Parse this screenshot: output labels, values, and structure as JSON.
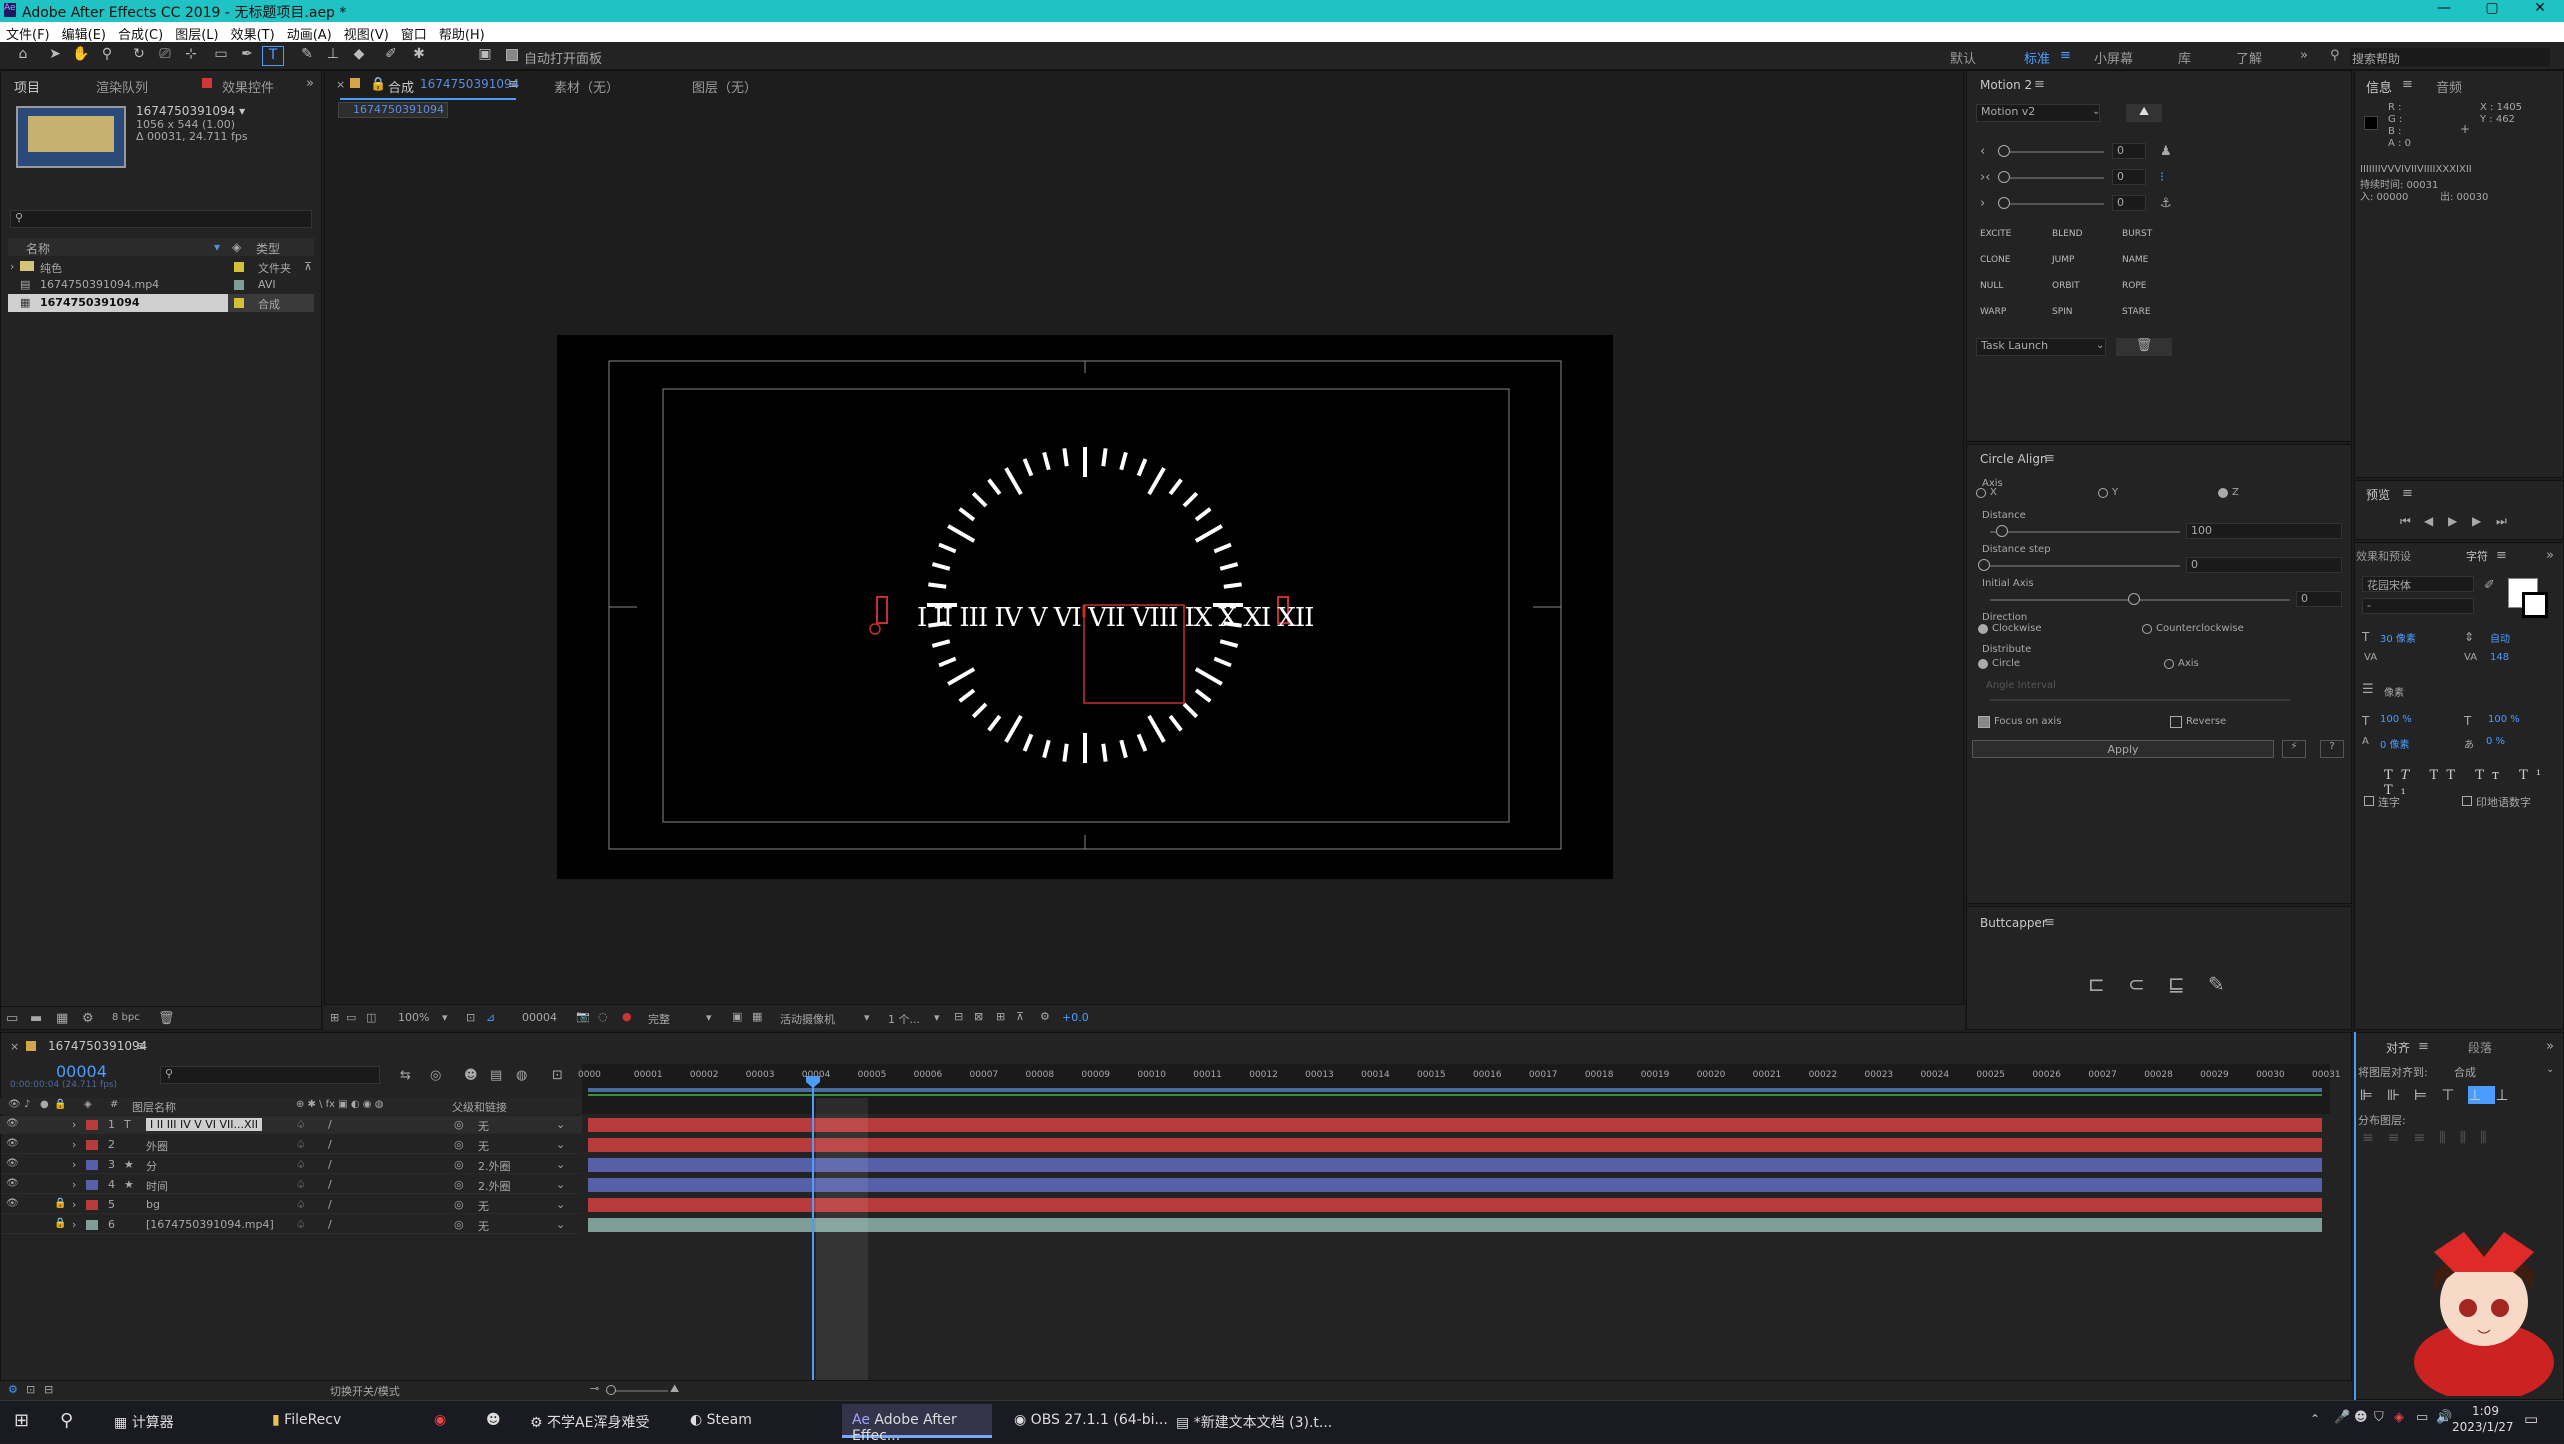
{
  "window": {
    "title": "Adobe After Effects CC 2019 - 无标题项目.aep *",
    "controls": [
      "—",
      "▢",
      "✕"
    ]
  },
  "menu": [
    "文件(F)",
    "编辑(E)",
    "合成(C)",
    "图层(L)",
    "效果(T)",
    "动画(A)",
    "视图(V)",
    "窗口",
    "帮助(H)"
  ],
  "toolbar": {
    "auto_open": "自动打开面板",
    "workspaces": [
      "默认",
      "标准",
      "小屏幕",
      "库",
      "了解"
    ],
    "active_ws": "标准",
    "search_placeholder": "搜索帮助"
  },
  "project": {
    "tabs": [
      "项目",
      "渲染队列",
      "效果控件"
    ],
    "item_name": "1674750391094 ▾",
    "item_dims": "1056 x 544 (1.00)",
    "item_dur": "Δ 00031, 24.711 fps",
    "cols": {
      "name": "名称",
      "type": "类型"
    },
    "items": [
      {
        "name": "纯色",
        "type": "文件夹"
      },
      {
        "name": "1674750391094.mp4",
        "type": "AVI"
      },
      {
        "name": "1674750391094",
        "type": "合成"
      }
    ],
    "bpc": "8 bpc"
  },
  "comp": {
    "tab_label": "合成",
    "tab_name": "1674750391094",
    "footage_tab": "素材（无）",
    "layer_tab": "图层（无）",
    "breadcrumb": "1674750391094",
    "clock_text": "I II III IV V VI VII VIII IX X XI XII",
    "bottom": {
      "zoom": "100%",
      "frame": "00004",
      "quality": "完整",
      "camera": "活动摄像机",
      "views": "1 个...",
      "exposure": "+0.0"
    }
  },
  "motion2": {
    "title": "Motion 2",
    "version": "Motion v2",
    "slider_values": [
      "0",
      "0",
      "0"
    ],
    "buttons": [
      "EXCITE",
      "BLEND",
      "BURST",
      "CLONE",
      "JUMP",
      "NAME",
      "NULL",
      "ORBIT",
      "ROPE",
      "WARP",
      "SPIN",
      "STARE"
    ],
    "task": "Task Launch"
  },
  "circle_align": {
    "title": "Circle Align",
    "axis_label": "Axis",
    "axes": [
      "X",
      "Y",
      "Z"
    ],
    "distance_label": "Distance",
    "distance": "100",
    "distance_step_label": "Distance step",
    "distance_step": "0",
    "initial_axis_label": "Initial Axis",
    "initial_axis": "0",
    "direction_label": "Direction",
    "dir_cw": "Clockwise",
    "dir_ccw": "Counterclockwise",
    "distribute_label": "Distribute",
    "dist_circle": "Circle",
    "dist_axis": "Axis",
    "angle_interval": "Angle Interval",
    "focus": "Focus on axis",
    "reverse": "Reverse",
    "apply": "Apply"
  },
  "buttcapper": {
    "title": "Buttcapper"
  },
  "info": {
    "tabs": [
      "信息",
      "音频"
    ],
    "rgba": [
      "R :",
      "G :",
      "B :",
      "A : 0"
    ],
    "x": "X : 1405",
    "y": "Y : 462",
    "text_line": "IIIIIIIVVVIVIIVIIIIXXXIXII",
    "dur": "持续时间: 00031",
    "in": "入: 00000",
    "out": "出: 00030"
  },
  "preview": {
    "title": "预览"
  },
  "character": {
    "tabs": [
      "效果和预设",
      "字符"
    ],
    "font": "花园宋体",
    "style": "-",
    "size": "30 像素",
    "leading": "自动",
    "tracking": "148",
    "units": "像素",
    "scale_v": "100 %",
    "scale_h": "100 %",
    "baseline": "0 像素",
    "tsume": "0 %",
    "ligature": "连字",
    "hindi": "印地语数字"
  },
  "align": {
    "tabs": [
      "对齐",
      "段落"
    ],
    "align_to": "将图层对齐到:",
    "align_target": "合成",
    "distribute": "分布图层:"
  },
  "timeline": {
    "tab_name": "1674750391094",
    "timecode": "00004",
    "timecode_sub": "0:00:00:04 (24.711 fps)",
    "col_layer": "图层名称",
    "col_parent": "父级和链接",
    "toggle": "切换开关/模式",
    "ticks": [
      "0000",
      "00001",
      "00002",
      "00003",
      "00004",
      "00005",
      "00006",
      "00007",
      "00008",
      "00009",
      "00010",
      "00011",
      "00012",
      "00013",
      "00014",
      "00015",
      "00016",
      "00017",
      "00018",
      "00019",
      "00020",
      "00021",
      "00022",
      "00023",
      "00024",
      "00025",
      "00026",
      "00027",
      "00028",
      "00029",
      "00030",
      "00031"
    ],
    "layers": [
      {
        "num": "1",
        "type": "T",
        "name": "I II III IV V VI VII...XII",
        "parent": "无",
        "color": "#b73b3b"
      },
      {
        "num": "2",
        "type": "",
        "name": "外圈",
        "parent": "无",
        "color": "#b73b3b"
      },
      {
        "num": "3",
        "type": "★",
        "name": "分",
        "parent": "2.外圈",
        "color": "#5560a8"
      },
      {
        "num": "4",
        "type": "★",
        "name": "时间",
        "parent": "2.外圈",
        "color": "#5560a8"
      },
      {
        "num": "5",
        "type": "",
        "name": "bg",
        "parent": "无",
        "color": "#b73b3b"
      },
      {
        "num": "6",
        "type": "",
        "name": "[1674750391094.mp4]",
        "parent": "无",
        "color": "#7e9e97"
      }
    ]
  },
  "taskbar": {
    "apps": [
      "计算器",
      "FileRecv",
      "",
      "",
      "不学AE浑身难受",
      "Steam",
      "Adobe After Effec...",
      "OBS 27.1.1 (64-bi...",
      "*新建文本文档 (3).t..."
    ],
    "time": "1:09",
    "date": "2023/1/27"
  }
}
